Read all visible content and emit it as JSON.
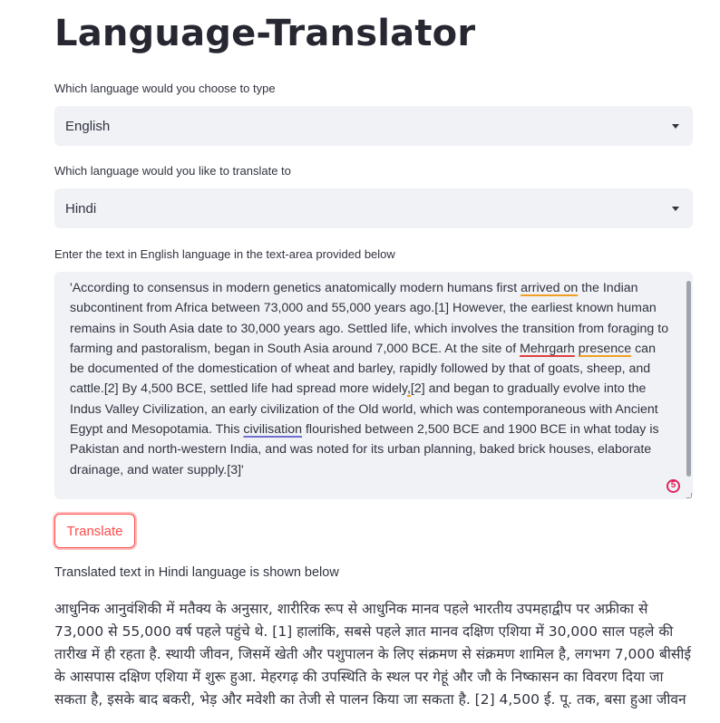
{
  "app": {
    "title": "Language-Translator"
  },
  "source_language": {
    "label": "Which language would you choose to type",
    "value": "English"
  },
  "target_language": {
    "label": "Which language would you like to translate to",
    "value": "Hindi"
  },
  "input": {
    "label": "Enter the text in English language in the text-area provided below",
    "text_parts": [
      "'According to consensus in modern genetics anatomically modern humans first ",
      "arrived on",
      " the Indian subcontinent from Africa between 73,000 and 55,000 years ago.[1] However, the earliest known human remains in South Asia date to 30,000 years ago. Settled life, which involves the transition from foraging to farming and pastoralism, began in South Asia around 7,000 BCE. At the site of ",
      "Mehrgarh",
      " ",
      "presence",
      " can be documented of the domestication of wheat and barley, rapidly followed by that of goats, sheep, and cattle.[2] By 4,500 BCE, settled life had spread more widely",
      ",",
      "[2] and began to gradually evolve into the Indus Valley Civilization, an early civilization of the Old world, which was contemporaneous with Ancient Egypt and Mesopotamia. This ",
      "civilisation",
      " flourished between 2,500 BCE and 1900 BCE in what today is Pakistan and north-western India, and was noted for its urban planning, baked brick houses, elaborate drainage, and water supply.[3]'"
    ],
    "badge_count": "5"
  },
  "translate_button": {
    "label": "Translate"
  },
  "output": {
    "label": "Translated text in Hindi language is shown below",
    "text": "आधुनिक आनुवंशिकी में मतैक्य के अनुसार, शारीरिक रूप से आधुनिक मानव पहले भारतीय उपमहाद्वीप पर अफ्रीका से 73,000 से 55,000 वर्ष पहले पहुंचे थे. [1] हालांकि, सबसे पहले ज्ञात मानव दक्षिण एशिया में 30,000 साल पहले की तारीख में ही रहता है. स्थायी जीवन, जिसमें खेती और पशुपालन के लिए संक्रमण से संक्रमण शामिल है, लगभग 7,000 बीसीई के आसपास दक्षिण एशिया में शुरू हुआ. मेहरगढ़ की उपस्थिति के स्थल पर गेहूं और जौ के निष्कासन का विवरण दिया जा सकता है, इसके बाद बकरी, भेड़ और मवेशी का तेजी से पालन किया जा सकता है. [2] 4,500 ई. पू. तक, बसा हुआ जीवन"
  },
  "colors": {
    "accent": "#ff4b4b",
    "field_bg": "#f0f2f6",
    "text": "#31333f"
  }
}
